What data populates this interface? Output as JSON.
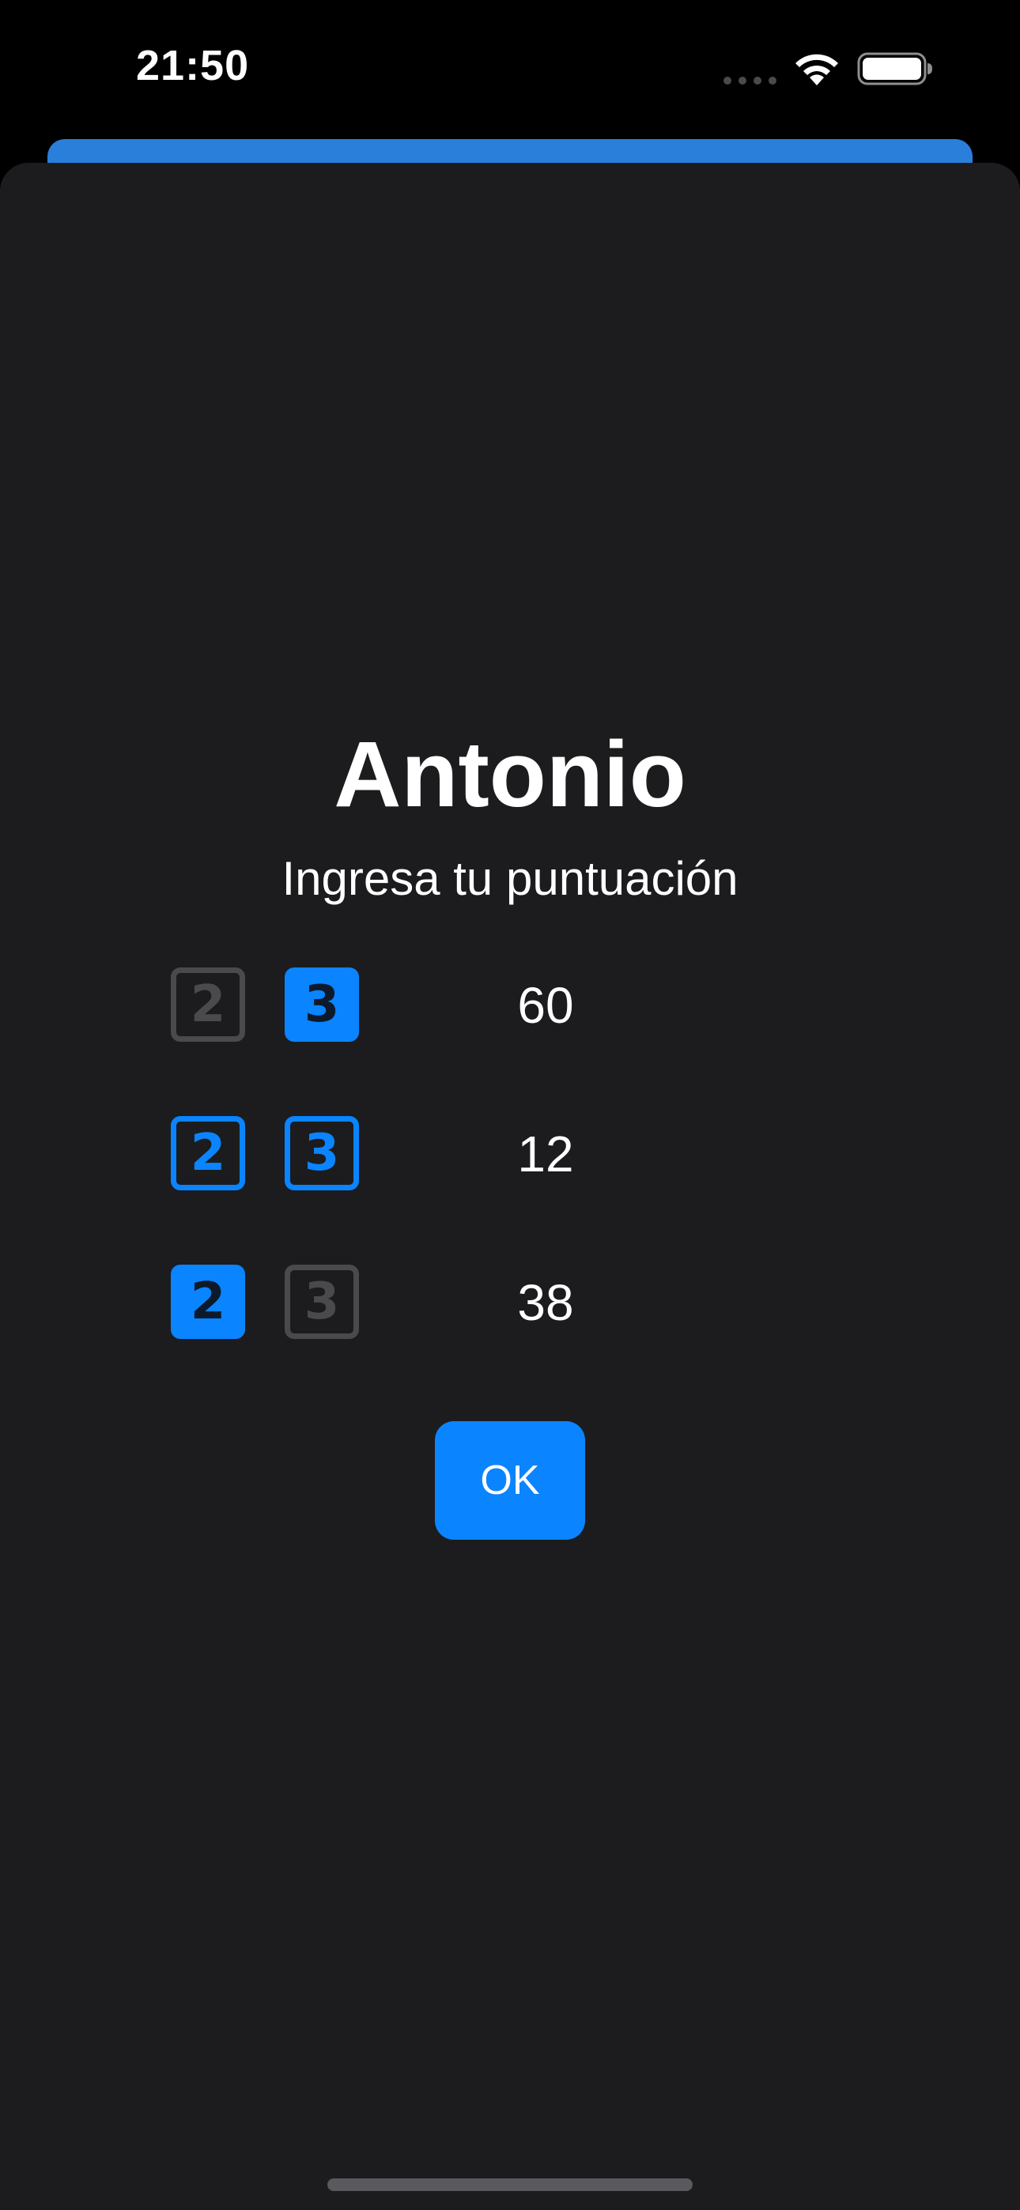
{
  "status_bar": {
    "time": "21:50",
    "icons": [
      "signal-dots-icon",
      "wifi-icon",
      "battery-icon"
    ]
  },
  "sheet": {
    "player_name": "Antonio",
    "subtitle": "Ingresa tu puntuación",
    "rows": [
      {
        "dice": [
          {
            "label": "2",
            "state": "inactive"
          },
          {
            "label": "3",
            "state": "selected"
          }
        ],
        "score": "60"
      },
      {
        "dice": [
          {
            "label": "2",
            "state": "outlined"
          },
          {
            "label": "3",
            "state": "outlined"
          }
        ],
        "score": "12"
      },
      {
        "dice": [
          {
            "label": "2",
            "state": "selected"
          },
          {
            "label": "3",
            "state": "inactive"
          }
        ],
        "score": "38"
      }
    ],
    "ok_label": "OK"
  },
  "colors": {
    "accent": "#0a84ff",
    "sheet_background": "#1c1c1e",
    "inactive": "#4a4a4c",
    "under_card": "#2a7fdb"
  }
}
